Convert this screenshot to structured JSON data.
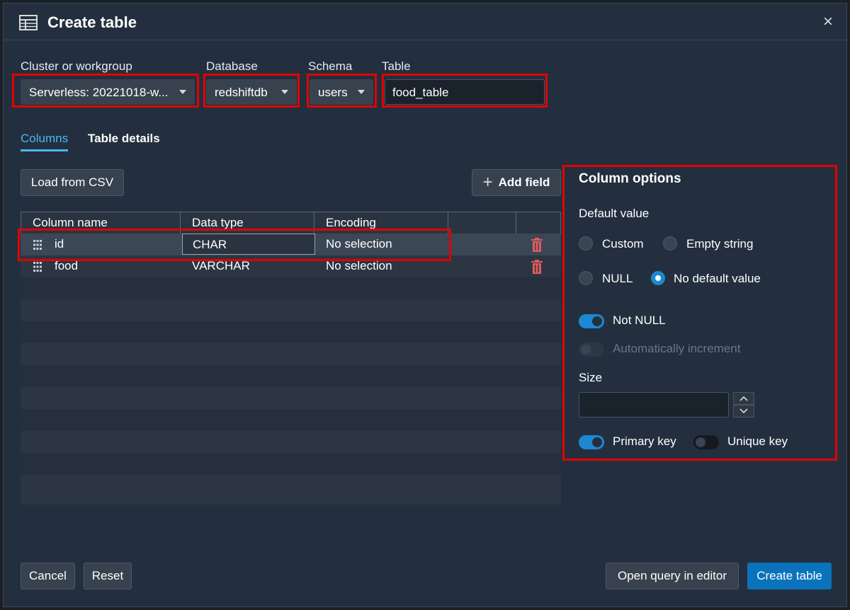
{
  "dialog": {
    "title": "Create table",
    "close_symbol": "×"
  },
  "fields": {
    "cluster_label": "Cluster or workgroup",
    "cluster_value": "Serverless: 20221018-w...",
    "database_label": "Database",
    "database_value": "redshiftdb",
    "schema_label": "Schema",
    "schema_value": "users",
    "table_label": "Table",
    "table_value": "food_table"
  },
  "tabs": [
    {
      "label": "Columns",
      "active": true
    },
    {
      "label": "Table details",
      "active": false
    }
  ],
  "toolbar": {
    "load_csv": "Load from CSV",
    "add_field": "Add field",
    "add_symbol": "+"
  },
  "grid": {
    "headers": [
      "Column name",
      "Data type",
      "Encoding"
    ],
    "rows": [
      {
        "name": "id",
        "type": "CHAR",
        "encoding": "No selection"
      },
      {
        "name": "food",
        "type": "VARCHAR",
        "encoding": "No selection"
      }
    ]
  },
  "column_options": {
    "title": "Column options",
    "default_value_label": "Default value",
    "radio_custom": "Custom",
    "radio_empty": "Empty string",
    "radio_null": "NULL",
    "radio_none": "No default value",
    "selected": "No default value",
    "not_null_label": "Not NULL",
    "not_null": true,
    "auto_inc_label": "Automatically increment",
    "auto_inc": false,
    "size_label": "Size",
    "size_value": "",
    "primary_key_label": "Primary key",
    "primary_key": true,
    "unique_key_label": "Unique key",
    "unique_key": false
  },
  "footer": {
    "cancel": "Cancel",
    "reset": "Reset",
    "open_editor": "Open query in editor",
    "create": "Create table"
  },
  "colors": {
    "accent": "#44b9f0",
    "primary_button": "#0a73bb",
    "highlight": "#e30000",
    "trash": "#e05b5b"
  },
  "icons": [
    "table-icon",
    "close-icon",
    "caret-down-icon",
    "plus-icon",
    "drag-handle-icon",
    "trash-icon",
    "chevron-up-icon",
    "chevron-down-icon"
  ]
}
